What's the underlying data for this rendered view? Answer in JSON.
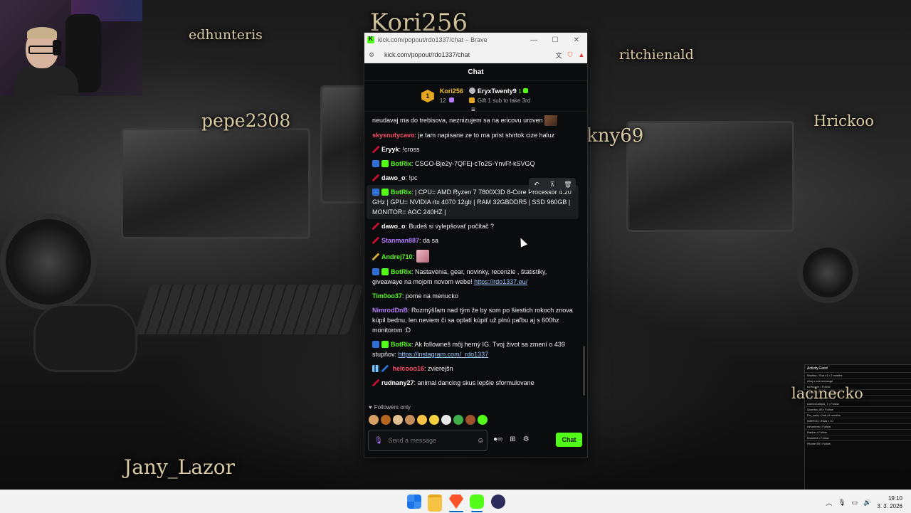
{
  "stream_overlay": {
    "names": [
      "Kori256",
      "edhunteris",
      "ritchienald",
      "pepe2308",
      "kny69",
      "Hrickoo",
      "lacinecko",
      "Jany_Lazor"
    ]
  },
  "activity_feed": {
    "title": "Activity Feed",
    "rows": [
      "Boshka • Sub x1 • 2 months",
      "Ahoj a sub message",
      "kurfsware • Follow",
      "rudnany27 • Sub x1 month",
      "Eryx Twenty9 • Follow",
      "DamioGalepki_7 • Follow",
      "Queniko_88 • Follow",
      "Pio_cady • Sub x3 months",
      "NIMROD • Raid x 10",
      "rdhunteris • Follow",
      "Rabbin • Follow",
      "Brukleti4 • Follow",
      "Pilotne 89 • Follow"
    ]
  },
  "browser": {
    "title": "kick.com/popout/rdo1337/chat – Brave",
    "url": "kick.com/popout/rdo1337/chat",
    "minimize": "—",
    "maximize": "☐",
    "close": "✕"
  },
  "chat": {
    "header": "Chat",
    "gifters": {
      "first": {
        "rank": "1",
        "name": "Kori256",
        "count": "12"
      },
      "second": {
        "name": "EryxTwenty9",
        "count": "1"
      },
      "gift_cta": "Gift 1 sub to take 3rd"
    },
    "messages": [
      {
        "user": "",
        "user_color": "#53fc18",
        "text": "neudavaj ma do trebisova, neznizujem sa na ericovu uroven",
        "emote": "face"
      },
      {
        "user": "skysnutycavo",
        "user_color": "#ff4d6d",
        "text": "je tam napisane ze to ma prist stvrtok cize haluz"
      },
      {
        "user": "Eryyk",
        "user_color": "#ffffff",
        "badges": [
          "slash"
        ],
        "text": "!cross"
      },
      {
        "user": "BotRix",
        "user_color": "#53fc18",
        "badges": [
          "bot",
          "verified"
        ],
        "text": "CSGO-Bje2y-7QFEj-cTo2S-YnvFf-kSVGQ"
      },
      {
        "user": "dawo_o",
        "user_color": "#ffffff",
        "badges": [
          "slash"
        ],
        "text": "!pc"
      },
      {
        "user": "BotRix",
        "user_color": "#53fc18",
        "badges": [
          "bot",
          "verified"
        ],
        "text": "| CPU= AMD Ryzen 7 7800X3D 8-Core Processor 4.20 GHz | GPU= NVIDIA rtx 4070 12gb | RAM 32GBDDR5 | SSD 960GB | MONITOR= AOC 240HZ |",
        "highlight": true
      },
      {
        "user": "dawo_o",
        "user_color": "#ffffff",
        "badges": [
          "slash"
        ],
        "text": "Budeš si vylepšovať počítač ?"
      },
      {
        "user": "Stanman887",
        "user_color": "#b67bff",
        "badges": [
          "slash"
        ],
        "text": "da sa"
      },
      {
        "user": "Andrej710",
        "user_color": "#53fc18",
        "badges": [
          "slash-g"
        ],
        "text": "",
        "emote": "pink"
      },
      {
        "user": "BotRix",
        "user_color": "#53fc18",
        "badges": [
          "bot",
          "verified"
        ],
        "text": "Nastavenia, gear, novinky, recenzie , štatistiky, giveawaye na mojom novom webe! ",
        "link": "https://rdo1337.eu/"
      },
      {
        "user": "Tim0oo37",
        "user_color": "#53fc18",
        "text": "pome na menucko"
      },
      {
        "user": "NimrodDnB",
        "user_color": "#b67bff",
        "text": "Rozmýšľam nad tým že by som po šiestich rokoch znova kúpil bednu, len neviem či sa oplatí kúpiť už plnú paľbu aj s 600hz monitorom :D"
      },
      {
        "user": "BotRix",
        "user_color": "#53fc18",
        "badges": [
          "bot",
          "verified"
        ],
        "text": "Ak followneš môj herný IG. Tvoj život sa zmení o 439 stupňov: ",
        "link": "https://instagram.com/_rdo1337"
      },
      {
        "user": "helcooo16",
        "user_color": "#ff4d6d",
        "badges": [
          "grid",
          "slash-b"
        ],
        "text": "zvierejšn"
      },
      {
        "user": "rudnany27",
        "user_color": "#ffffff",
        "badges": [
          "slash"
        ],
        "text": "animal dancing skus lepšie sformulovane"
      }
    ],
    "message_actions": [
      "↶",
      "⊼",
      "🗑"
    ],
    "followers_only": "Followers only",
    "composer_placeholder": "Send a message",
    "send_label": "Chat"
  },
  "taskbar": {
    "time": "19:10",
    "date": "3. 3. 2026"
  }
}
